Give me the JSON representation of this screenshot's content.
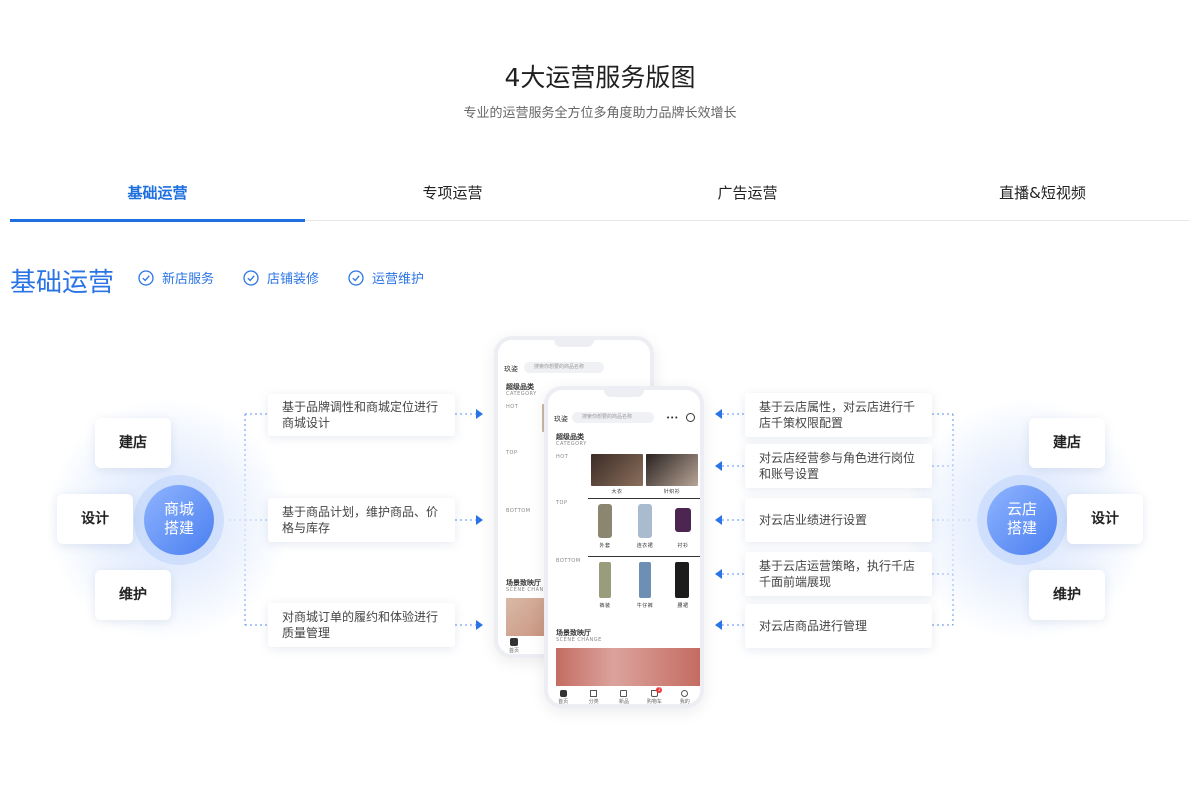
{
  "header": {
    "title": "4大运营服务版图",
    "subtitle": "专业的运营服务全方位多角度助力品牌长效增长"
  },
  "tabs": [
    {
      "label": "基础运营",
      "active": true
    },
    {
      "label": "专项运营",
      "active": false
    },
    {
      "label": "广告运营",
      "active": false
    },
    {
      "label": "直播&短视频",
      "active": false
    }
  ],
  "section": {
    "title": "基础运营",
    "checks": [
      "新店服务",
      "店铺装修",
      "运营维护"
    ]
  },
  "left_hub": {
    "label_line1": "商城",
    "label_line2": "搭建",
    "nodes": [
      "建店",
      "设计",
      "维护"
    ],
    "items": [
      "基于品牌调性和商城定位进行商城设计",
      "基于商品计划，维护商品、价格与库存",
      "对商城订单的履约和体验进行质量管理"
    ]
  },
  "right_hub": {
    "label_line1": "云店",
    "label_line2": "搭建",
    "nodes": [
      "建店",
      "设计",
      "维护"
    ],
    "items": [
      "基于云店属性，对云店进行千店千策权限配置",
      "对云店经营参与角色进行岗位和账号设置",
      "对云店业绩进行设置",
      "基于云店运营策略，执行千店千面前端展现",
      "对云店商品进行管理"
    ]
  },
  "phone": {
    "brand": "玖姿",
    "search_placeholder": "搜索你想要的商品名称",
    "category_title": "超级品类",
    "category_en": "CATEGORY",
    "row_hot": "HOT",
    "row_top": "TOP",
    "row_bottom": "BOTTOM",
    "hot_items": [
      "大衣",
      "针织衫"
    ],
    "top_items": [
      "外套",
      "连衣裙",
      "衬衫"
    ],
    "bottom_items": [
      "裤装",
      "牛仔裤",
      "腰裙"
    ],
    "scene_title": "场景致映厅",
    "scene_en": "SCENE CHANGE",
    "nav": [
      "首页",
      "分类",
      "新品",
      "购物车",
      "我的"
    ],
    "cart_badge": "2"
  },
  "colors": {
    "accent": "#1e6fe0",
    "section_blue": "#2b74e6",
    "hub_gradient_start": "#8fb4ff",
    "hub_gradient_end": "#4a7ff0"
  }
}
